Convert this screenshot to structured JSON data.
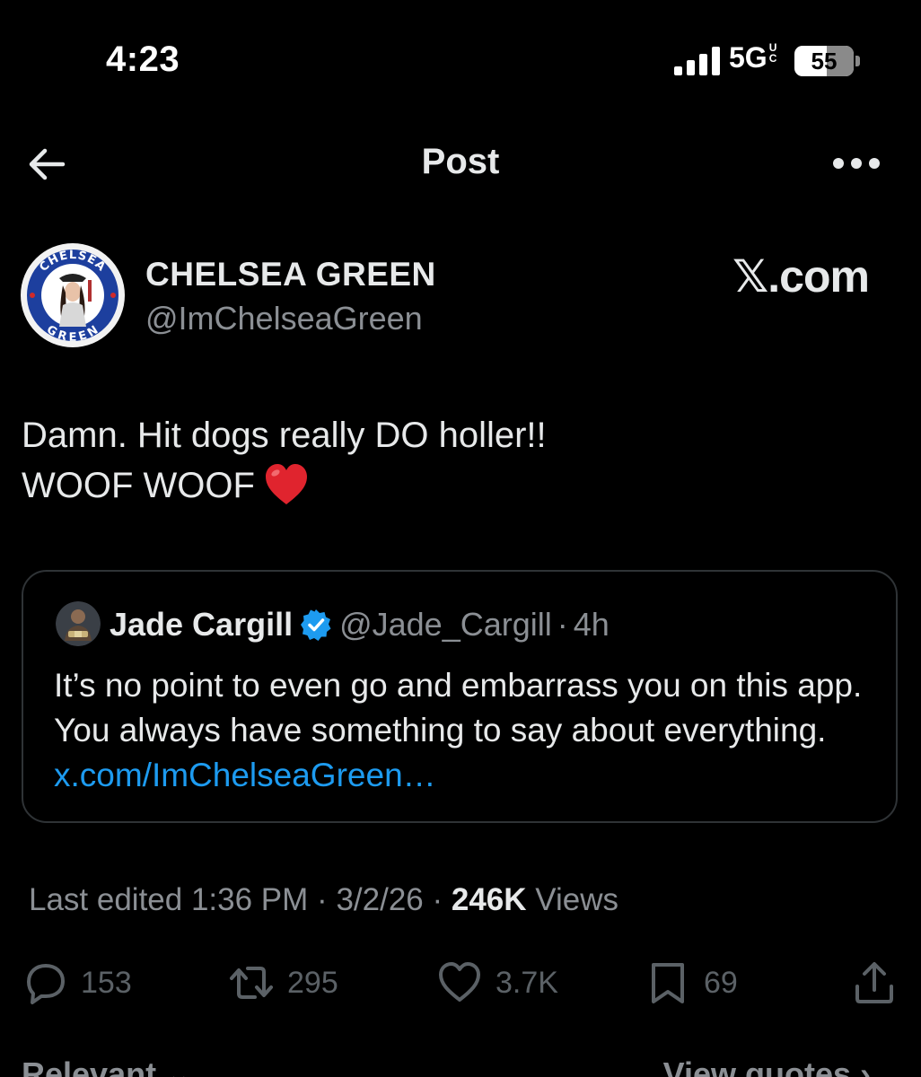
{
  "status_bar": {
    "time": "4:23",
    "network": "5G",
    "network_badge": "UC",
    "battery_level": "55",
    "icons": [
      "signal-bars-icon",
      "battery-icon"
    ]
  },
  "header": {
    "title": "Post",
    "back_icon": "arrow-left-icon",
    "more_icon": "more-horizontal-icon"
  },
  "post": {
    "author_name": "CHELSEA GREEN",
    "author_handle": "@ImChelseaGreen",
    "avatar_badge_top": "CHELSEA",
    "avatar_badge_bottom": "GREEN",
    "watermark": "𝕏.com",
    "text_line_1": "Damn. Hit dogs really DO holler!!",
    "text_line_2": "WOOF WOOF",
    "emoji_icon": "red-heart-icon"
  },
  "quote": {
    "name": "Jade Cargill",
    "handle": "@Jade_Cargill",
    "separator": "·",
    "time": "4h",
    "verified_icon": "verified-badge-icon",
    "text": "It’s no point to even go and embarrass you on this app. You always have something to say about everything.",
    "link": "x.com/ImChelseaGreen…"
  },
  "meta": {
    "edited": "Last edited 1:36 PM",
    "date": "3/2/26",
    "separator": "·",
    "views_count": "246K",
    "views_label": "Views"
  },
  "actions": {
    "replies": "153",
    "reposts": "295",
    "likes": "3.7K",
    "bookmarks": "69",
    "icons": [
      "reply-icon",
      "repost-icon",
      "like-icon",
      "bookmark-icon",
      "share-icon"
    ]
  },
  "footer": {
    "left_label": "Relevant ⌄",
    "right_label": "View quotes ›"
  },
  "colors": {
    "background": "#000000",
    "text": "#e7e9ea",
    "muted": "#8b8f94",
    "link": "#1d9bf0",
    "border": "#2f3336",
    "heart": "#e0242e"
  }
}
